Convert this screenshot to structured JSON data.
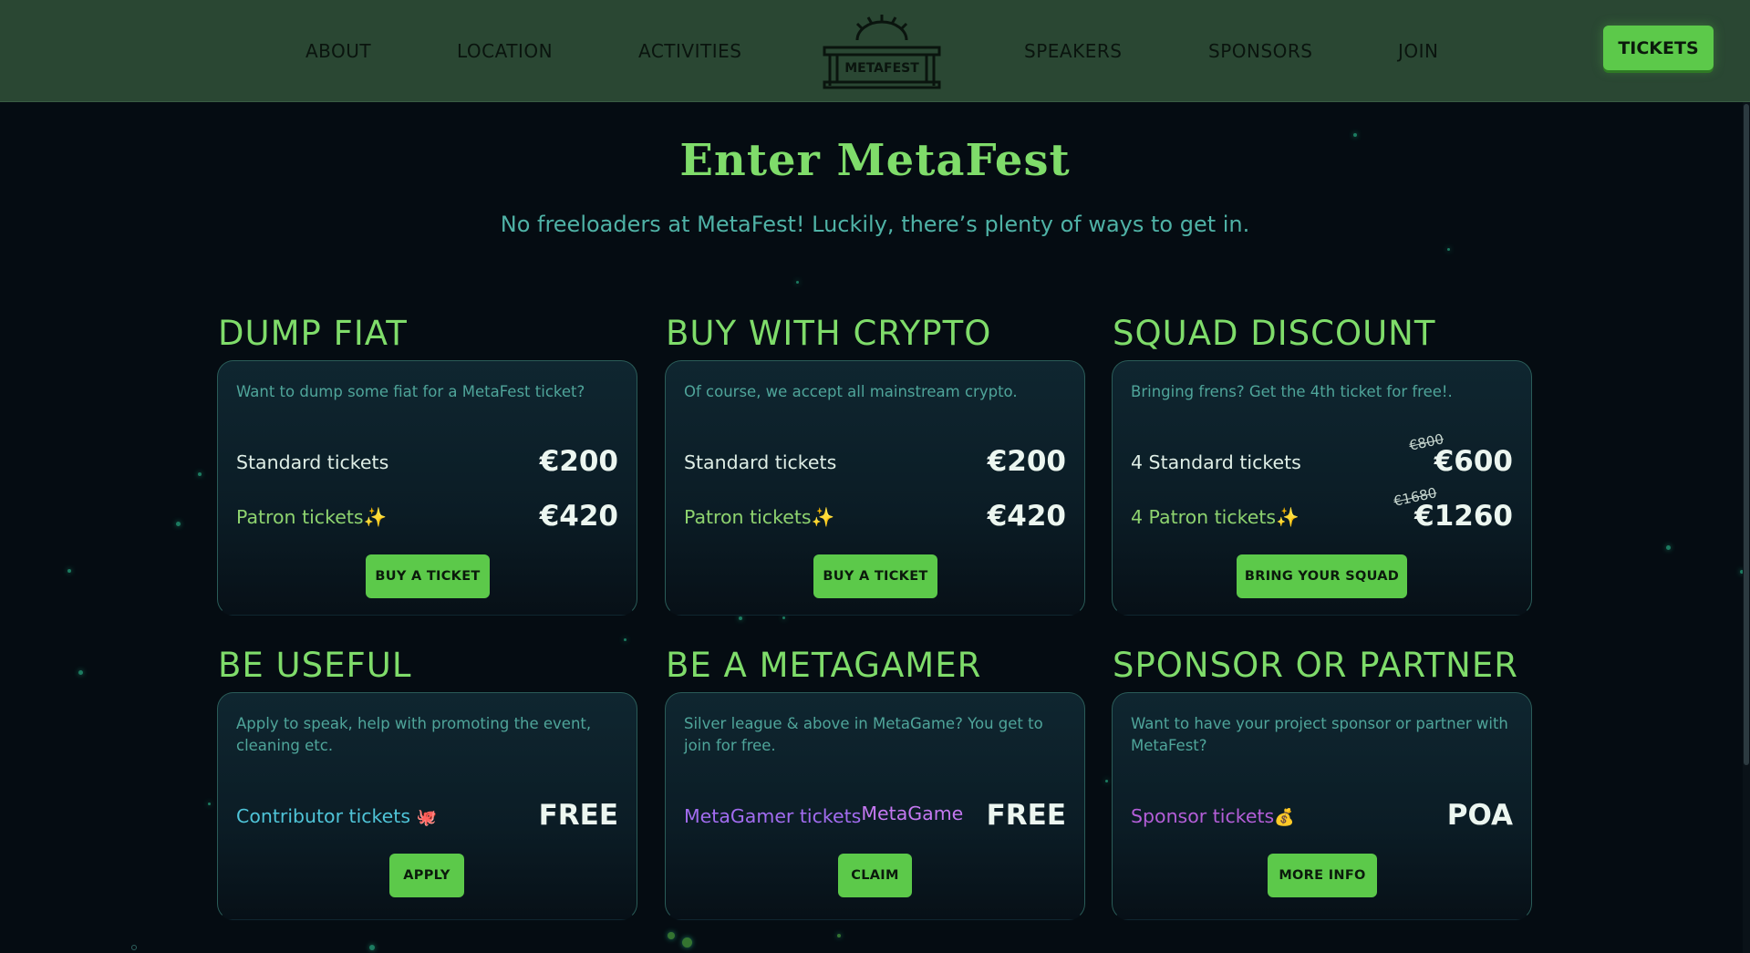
{
  "nav": {
    "left": [
      "ABOUT",
      "LOCATION",
      "ACTIVITIES"
    ],
    "right": [
      "SPEAKERS",
      "SPONSORS",
      "JOIN"
    ],
    "logo_text": "METAFEST",
    "tickets_label": "TICKETS"
  },
  "hero": {
    "title": "Enter MetaFest",
    "subtitle": "No freeloaders at MetaFest! Luckily, there’s plenty of ways to get in."
  },
  "cards": [
    {
      "title": "DUMP FIAT",
      "desc": "Want to dump some fiat for a MetaFest ticket?",
      "rows": [
        {
          "label": "Standard tickets",
          "price": "€200"
        },
        {
          "label": "Patron tickets✨",
          "price": "€420"
        }
      ],
      "button": "BUY A TICKET"
    },
    {
      "title": "BUY WITH CRYPTO",
      "desc": "Of course, we accept all mainstream crypto.",
      "rows": [
        {
          "label": "Standard tickets",
          "price": "€200"
        },
        {
          "label": "Patron tickets✨",
          "price": "€420"
        }
      ],
      "button": "BUY A TICKET"
    },
    {
      "title": "SQUAD DISCOUNT",
      "desc": "Bringing frens? Get the 4th ticket for free!.",
      "rows": [
        {
          "label": "4 Standard tickets",
          "price": "€600",
          "old_price": "€800"
        },
        {
          "label": "4 Patron tickets✨",
          "price": "€1260",
          "old_price": "€1680"
        }
      ],
      "button": "BRING YOUR SQUAD"
    },
    {
      "title": "BE USEFUL",
      "desc": "Apply to speak, help with promoting the event, cleaning etc.",
      "rows": [
        {
          "label": "Contributor tickets",
          "emoji": "🐙",
          "price": "FREE"
        }
      ],
      "button": "APPLY"
    },
    {
      "title": "BE A METAGAMER",
      "desc": "Silver league & above in MetaGame? You get to join for free.",
      "rows": [
        {
          "label": "MetaGamer tickets",
          "suffix": "MetaGame",
          "price": "FREE"
        }
      ],
      "button": "CLAIM"
    },
    {
      "title": "SPONSOR OR PARTNER",
      "desc": "Want to have your project sponsor or partner with MetaFest?",
      "rows": [
        {
          "label": "Sponsor tickets",
          "emoji": "💰",
          "price": "POA"
        }
      ],
      "button": "MORE INFO"
    }
  ],
  "colors": {
    "header_bg": "#2a4733",
    "accent_green": "#5cc94a",
    "title_green": "#7fdc6a",
    "subtitle_teal": "#4fb2a6",
    "page_bg": "#050c12"
  }
}
